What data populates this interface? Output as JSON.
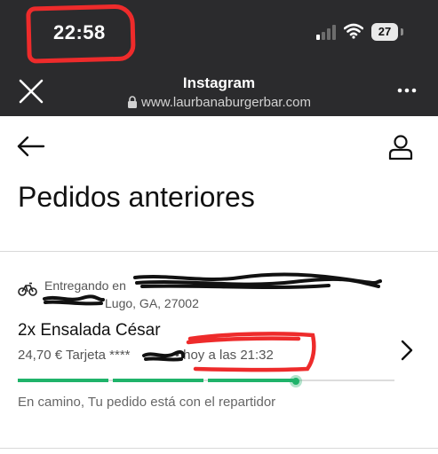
{
  "status_bar": {
    "time": "22:58",
    "battery": "27"
  },
  "browser": {
    "title": "Instagram",
    "url": "www.laurbanaburgerbar.com"
  },
  "page": {
    "title": "Pedidos anteriores"
  },
  "order": {
    "delivery_label": "Entregando en",
    "address_city": "Lugo, GA, 27002",
    "item": "2x Ensalada César",
    "price": "24,70 €",
    "payment": "Tarjeta",
    "card_masked": "****",
    "separator": "•",
    "eta": "hoy a las 21:32",
    "status": "En camino, Tu pedido está con el repartidor",
    "progress_fraction": 0.74
  },
  "colors": {
    "topbar": "#2b2b2d",
    "progress_green": "#1fb36a",
    "progress_track": "#dcdcdc",
    "annotation_red": "#ee2b2b"
  }
}
